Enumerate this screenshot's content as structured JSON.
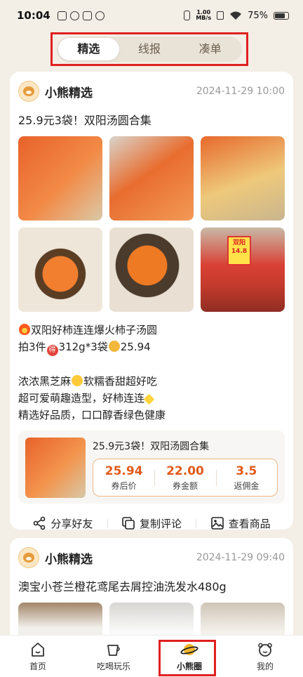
{
  "status_bar": {
    "time": "10:04",
    "net_speed_top": "1.00",
    "net_speed_bottom": "MB/s",
    "battery": "75%"
  },
  "tabs": [
    {
      "label": "精选",
      "active": true
    },
    {
      "label": "线报",
      "active": false
    },
    {
      "label": "凑单",
      "active": false
    }
  ],
  "posts": [
    {
      "author": "小熊精选",
      "time": "2024-11-29 10:00",
      "title": "25.9元3袋！双阳汤圆合集",
      "photo_price_tag": "双阳 14.8",
      "desc_lines": [
        "双阳好柿连连爆火柿子汤圆",
        "拍3件",
        "312g*3袋",
        "25.94",
        "浓浓黑芝麻",
        "软糯香甜超好吃",
        "超可爱萌趣造型，好柿连连",
        "精选好品质，口口醇香绿色健康"
      ],
      "emoji_de": "得",
      "product": {
        "title": "25.9元3袋！双阳汤圆合集",
        "stats": [
          {
            "value": "25.94",
            "label": "券后价"
          },
          {
            "value": "22.00",
            "label": "券金额"
          },
          {
            "value": "3.5",
            "label": "返佣金"
          }
        ]
      },
      "actions": [
        {
          "label": "分享好友",
          "icon": "share-icon"
        },
        {
          "label": "复制评论",
          "icon": "copy-icon"
        },
        {
          "label": "查看商品",
          "icon": "image-icon"
        }
      ]
    },
    {
      "author": "小熊精选",
      "time": "2024-11-29 09:40",
      "title": "澳宝小苍兰橙花鸢尾去屑控油洗发水480g"
    }
  ],
  "bottom_nav": [
    {
      "label": "首页",
      "icon": "home-icon",
      "active": false
    },
    {
      "label": "吃喝玩乐",
      "icon": "cup-icon",
      "active": false
    },
    {
      "label": "小熊圈",
      "icon": "planet-icon",
      "active": true
    },
    {
      "label": "我的",
      "icon": "bear-face-icon",
      "active": false
    }
  ],
  "colors": {
    "accent": "#e25a1c",
    "highlight_box": "#e02020",
    "background": "#f3eee6"
  }
}
